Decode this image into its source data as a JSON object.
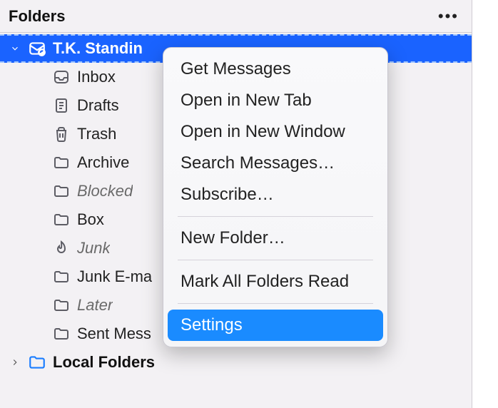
{
  "header": {
    "title": "Folders"
  },
  "account": {
    "name": "T.K. Standin"
  },
  "folders": [
    {
      "label": "Inbox",
      "icon": "inbox-icon",
      "italic": false
    },
    {
      "label": "Drafts",
      "icon": "drafts-icon",
      "italic": false
    },
    {
      "label": "Trash",
      "icon": "trash-icon",
      "italic": false
    },
    {
      "label": "Archive",
      "icon": "folder-icon",
      "italic": false
    },
    {
      "label": "Blocked",
      "icon": "folder-icon",
      "italic": true
    },
    {
      "label": "Box",
      "icon": "folder-icon",
      "italic": false
    },
    {
      "label": "Junk",
      "icon": "junk-icon",
      "italic": true
    },
    {
      "label": "Junk E-ma",
      "icon": "folder-icon",
      "italic": false
    },
    {
      "label": "Later",
      "icon": "folder-icon",
      "italic": true
    },
    {
      "label": "Sent Mess",
      "icon": "folder-icon",
      "italic": false
    }
  ],
  "local": {
    "label": "Local Folders"
  },
  "menu": {
    "items": [
      {
        "label": "Get Messages"
      },
      {
        "label": "Open in New Tab"
      },
      {
        "label": "Open in New Window"
      },
      {
        "label": "Search Messages…"
      },
      {
        "label": "Subscribe…"
      },
      {
        "sep": true
      },
      {
        "label": "New Folder…"
      },
      {
        "sep": true
      },
      {
        "label": "Mark All Folders Read"
      },
      {
        "sep": true
      },
      {
        "label": "Settings",
        "highlight": true
      }
    ]
  }
}
